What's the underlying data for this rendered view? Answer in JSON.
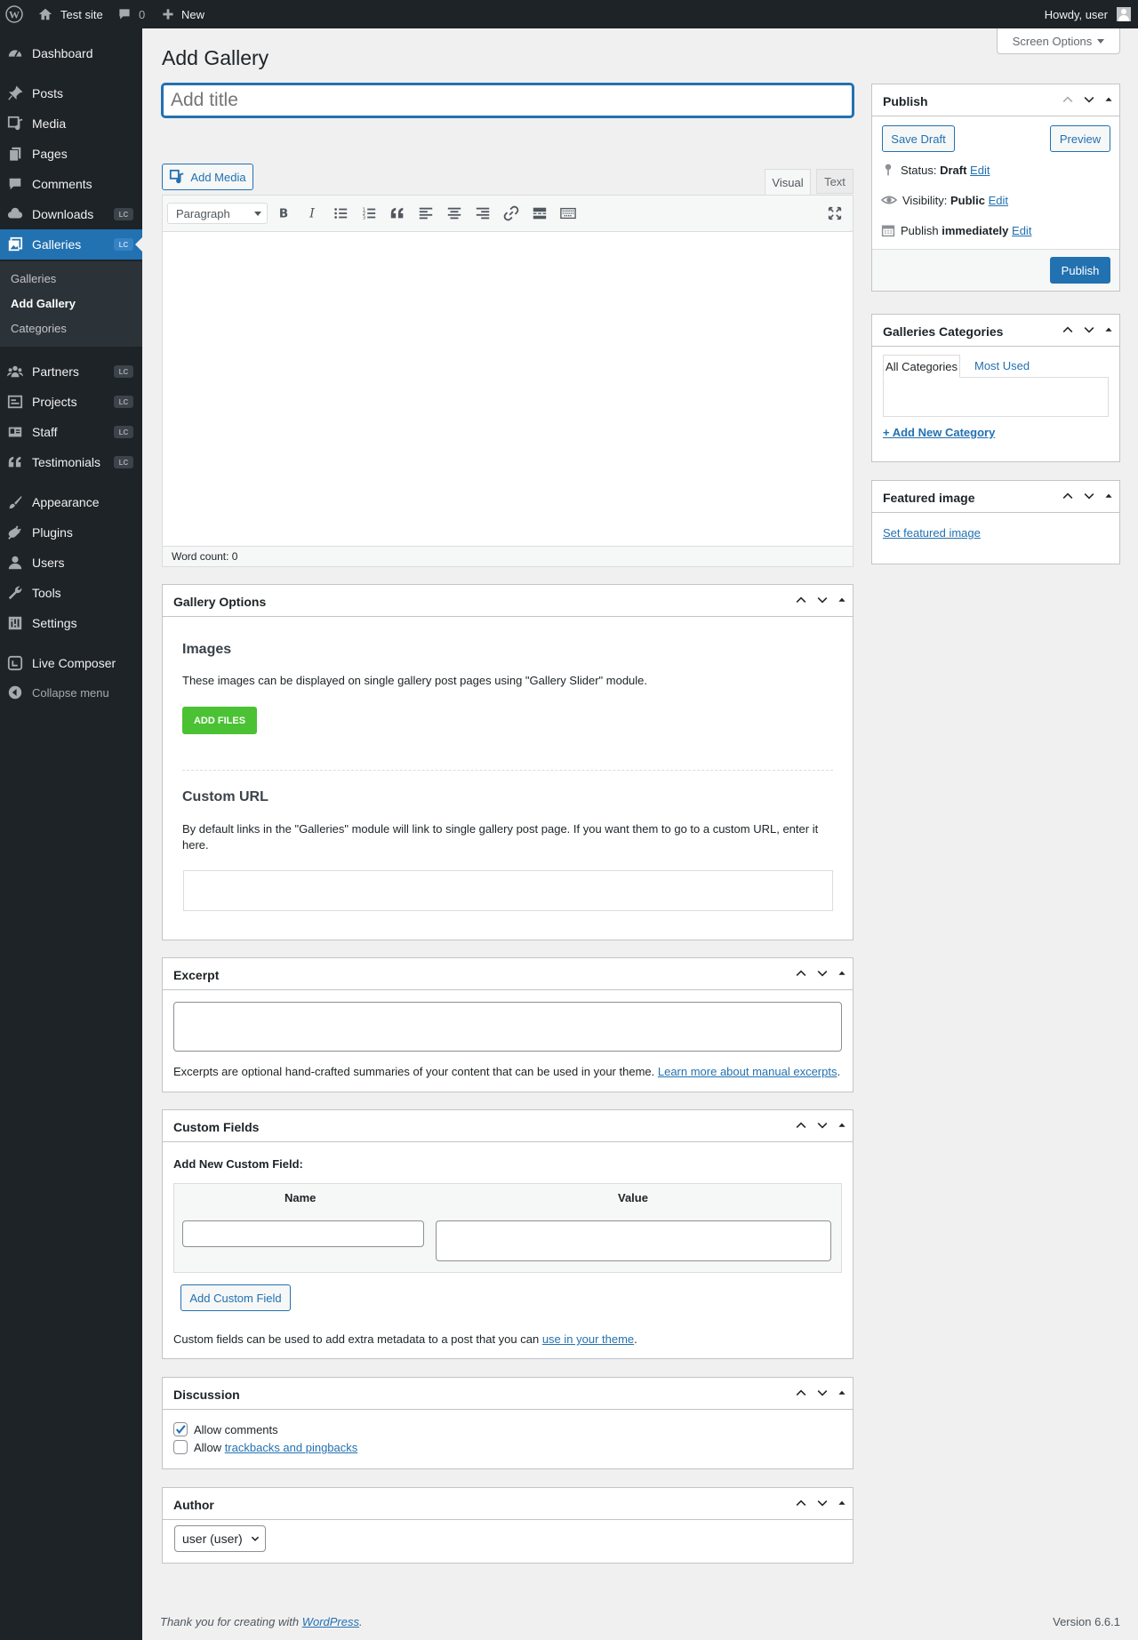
{
  "adminbar": {
    "site": "Test site",
    "comments": "0",
    "new": "New",
    "howdy": "Howdy, user"
  },
  "menu": {
    "dashboard": "Dashboard",
    "posts": "Posts",
    "media": "Media",
    "pages": "Pages",
    "comments": "Comments",
    "downloads": "Downloads",
    "galleries": "Galleries",
    "badge": "LC",
    "sub_galleries": "Galleries",
    "sub_add": "Add Gallery",
    "sub_categories": "Categories",
    "partners": "Partners",
    "projects": "Projects",
    "staff": "Staff",
    "testimonials": "Testimonials",
    "appearance": "Appearance",
    "plugins": "Plugins",
    "users": "Users",
    "tools": "Tools",
    "settings": "Settings",
    "live_composer": "Live Composer",
    "collapse": "Collapse menu"
  },
  "page": {
    "title": "Add Gallery",
    "screen_options": "Screen Options",
    "title_placeholder": "Add title"
  },
  "editor": {
    "add_media": "Add Media",
    "tab_visual": "Visual",
    "tab_text": "Text",
    "format": "Paragraph",
    "word_count": "Word count: 0"
  },
  "publish": {
    "title": "Publish",
    "save_draft": "Save Draft",
    "preview": "Preview",
    "status_label": "Status: ",
    "status_value": "Draft",
    "visibility_label": "Visibility: ",
    "visibility_value": "Public",
    "publish_label": "Publish ",
    "publish_value": "immediately",
    "edit": "Edit",
    "publish_button": "Publish"
  },
  "categories": {
    "title": "Galleries Categories",
    "tab_all": "All Categories",
    "tab_most_used": "Most Used",
    "add_new": "+ Add New Category"
  },
  "featured": {
    "title": "Featured image",
    "set": "Set featured image"
  },
  "gallery_options": {
    "title": "Gallery Options",
    "images_heading": "Images",
    "images_desc": "These images can be displayed on single gallery post pages using \"Gallery Slider\" module.",
    "add_files": "ADD FILES",
    "url_heading": "Custom URL",
    "url_desc": "By default links in the \"Galleries\" module will link to single gallery post page. If you want them to go to a custom URL, enter it here."
  },
  "excerpt": {
    "title": "Excerpt",
    "desc": "Excerpts are optional hand-crafted summaries of your content that can be used in your theme. ",
    "link": "Learn more about manual excerpts"
  },
  "custom_fields": {
    "title": "Custom Fields",
    "add_new": "Add New Custom Field:",
    "col_name": "Name",
    "col_value": "Value",
    "button": "Add Custom Field",
    "desc": "Custom fields can be used to add extra metadata to a post that you can ",
    "link": "use in your theme"
  },
  "discussion": {
    "title": "Discussion",
    "allow_comments": "Allow comments",
    "allow_prefix": "Allow ",
    "trackbacks": "trackbacks and pingbacks"
  },
  "author": {
    "title": "Author",
    "value": "user (user)"
  },
  "footer": {
    "thanks": "Thank you for creating with ",
    "wp": "WordPress",
    "version": "Version 6.6.1"
  },
  "colors": {
    "primary": "#2271b1",
    "adminbar": "#1d2327",
    "green": "#4ac233"
  }
}
